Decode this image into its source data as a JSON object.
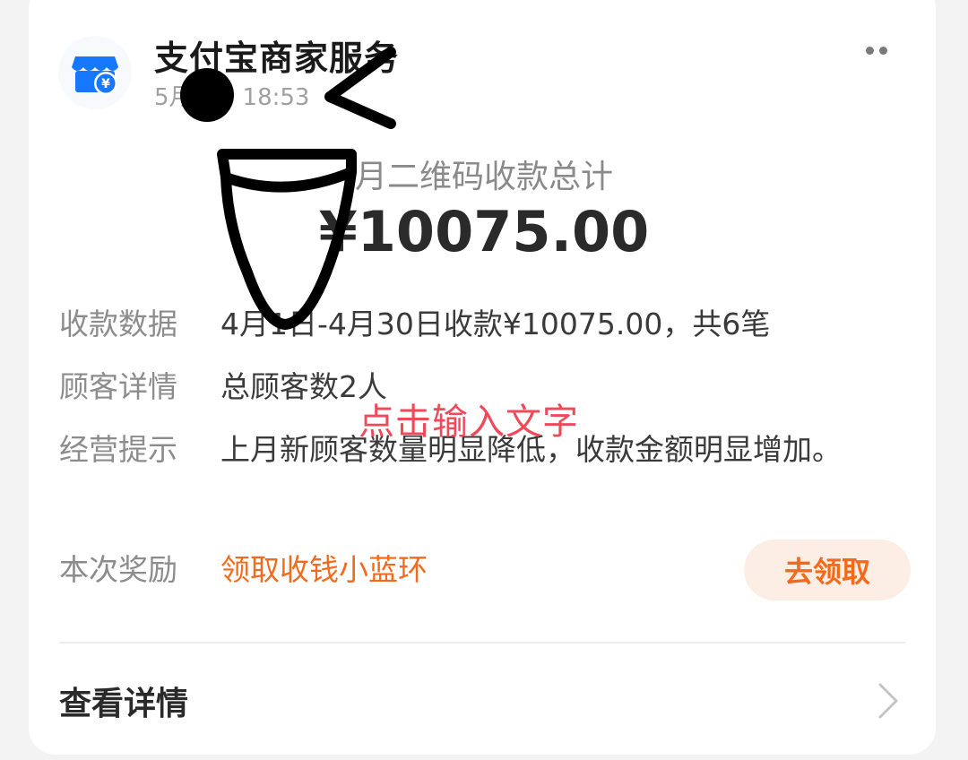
{
  "header": {
    "title": "支付宝商家服务",
    "time_prefix": "5月",
    "time_suffix": "18:53",
    "avatar_icon": "store-icon",
    "more_icon": "more-icon"
  },
  "summary": {
    "label": "月二维码收款总计",
    "amount": "¥10075.00"
  },
  "rows": [
    {
      "key": "收款数据",
      "value": "4月1日-4月30日收款¥10075.00，共6笔"
    },
    {
      "key": "顾客详情",
      "value": "总顾客数2人"
    },
    {
      "key": "经营提示",
      "value": "上月新顾客数量明显降低，收款金额明显增加。"
    },
    {
      "key": "本次奖励",
      "value": "领取收钱小蓝环"
    }
  ],
  "overlay_text": "点击输入文字",
  "claim_button": "去领取",
  "details_label": "查看详情",
  "colors": {
    "accent": "#f26b1d",
    "brand_blue": "#1677ff",
    "overlay_text": "#f04a5a"
  }
}
